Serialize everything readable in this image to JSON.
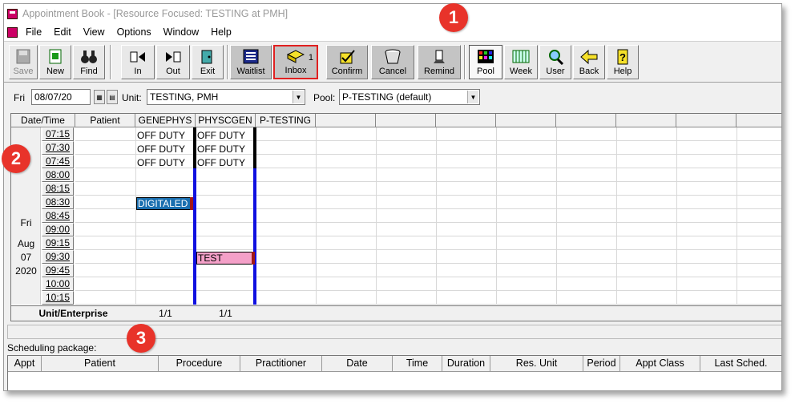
{
  "window": {
    "title": "Appointment Book - [Resource Focused:  TESTING at PMH]"
  },
  "menu": [
    "File",
    "Edit",
    "View",
    "Options",
    "Window",
    "Help"
  ],
  "toolbar": [
    {
      "label": "Save",
      "icon": "save-icon",
      "enabled": false
    },
    {
      "label": "New",
      "icon": "new-icon",
      "enabled": true
    },
    {
      "label": "Find",
      "icon": "binoculars-icon",
      "enabled": true
    },
    {
      "label": "In",
      "icon": "check-in-icon",
      "enabled": true
    },
    {
      "label": "Out",
      "icon": "check-out-icon",
      "enabled": true
    },
    {
      "label": "Exit",
      "icon": "exit-icon",
      "enabled": true
    },
    {
      "label": "Waitlist",
      "icon": "waitlist-icon",
      "enabled": true
    },
    {
      "label": "Inbox",
      "icon": "inbox-icon",
      "enabled": true,
      "count": "1"
    },
    {
      "label": "Confirm",
      "icon": "confirm-icon",
      "enabled": true
    },
    {
      "label": "Cancel",
      "icon": "cancel-icon",
      "enabled": true
    },
    {
      "label": "Remind",
      "icon": "remind-icon",
      "enabled": true
    },
    {
      "label": "Pool",
      "icon": "pool-icon",
      "enabled": true
    },
    {
      "label": "Week",
      "icon": "week-icon",
      "enabled": true
    },
    {
      "label": "User",
      "icon": "user-icon",
      "enabled": true
    },
    {
      "label": "Back",
      "icon": "back-arrow-icon",
      "enabled": true
    },
    {
      "label": "Help",
      "icon": "help-icon",
      "enabled": true
    }
  ],
  "filters": {
    "day": "Fri",
    "date": "08/07/20",
    "unit_label": "Unit:",
    "unit_value": "TESTING, PMH",
    "pool_label": "Pool:",
    "pool_value": "P-TESTING (default)"
  },
  "grid": {
    "headers": {
      "datetime": "Date/Time",
      "patient": "Patient",
      "res1": "GENEPHYS",
      "res2": "PHYSCGEN",
      "res3": "P-TESTING"
    },
    "date_column": {
      "day": "Fri",
      "month": "Aug",
      "dom": "07",
      "year": "2020"
    },
    "times": [
      "07:15",
      "07:30",
      "07:45",
      "08:00",
      "08:15",
      "08:30",
      "08:45",
      "09:00",
      "09:15",
      "09:30",
      "09:45",
      "10:00",
      "10:15"
    ],
    "off_duty": "OFF DUTY",
    "appointments": {
      "digitaled": "DIGITALED",
      "test": "TEST"
    },
    "footer": {
      "label": "Unit/Enterprise",
      "res1": "1/1",
      "res2": "1/1"
    }
  },
  "scheduling": {
    "label": "Scheduling package:",
    "columns": [
      "Appt",
      "Patient",
      "Procedure",
      "Practitioner",
      "Date",
      "Time",
      "Duration",
      "Res. Unit",
      "Period",
      "Appt Class",
      "Last Sched."
    ]
  },
  "badges": [
    "1",
    "2",
    "3"
  ],
  "colors": {
    "badge": "#e8332a",
    "appt_blue": "#1a6fb0",
    "appt_pink": "#f4a0c8",
    "resource_bar_blue": "#1010e0"
  }
}
